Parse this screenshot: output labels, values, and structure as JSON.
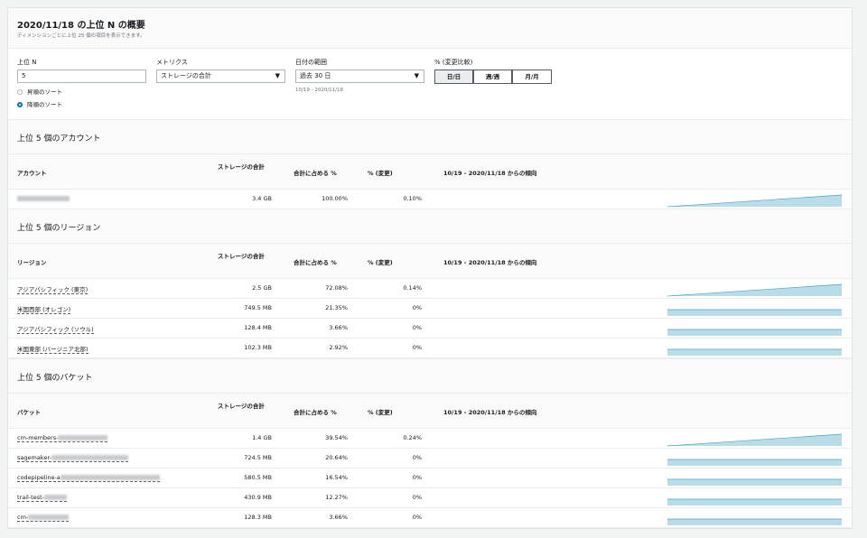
{
  "header": {
    "title": "2020/11/18 の上位 N の概要",
    "subtitle": "ディメンションごとに上位 25 個の項目を表示できます。"
  },
  "controls": {
    "topn_label": "上位 N",
    "topn_value": "5",
    "sort_asc": "昇順のソート",
    "sort_desc": "降順のソート",
    "metrics_label": "メトリクス",
    "metrics_value": "ストレージの合計",
    "date_label": "日付の範囲",
    "date_value": "過去 30 日",
    "date_hint": "10/19 - 2020/11/18",
    "compare_label": "% (変更比較)",
    "compare_options": [
      "日/日",
      "週/週",
      "月/月"
    ]
  },
  "columns": {
    "storage": "ストレージの合計",
    "percent": "合計に占める %",
    "change": "% (変更)",
    "trend": "10/19 - 2020/11/18 からの傾向"
  },
  "accounts": {
    "title": "上位 5 個のアカウント",
    "col_name": "アカウント",
    "rows": [
      {
        "name": "",
        "storage": "3.4 GB",
        "percent": "100.00%",
        "change": "0.10%",
        "trend": "rising"
      }
    ]
  },
  "regions": {
    "title": "上位 5 個のリージョン",
    "col_name": "リージョン",
    "rows": [
      {
        "name": "アジアパシフィック (東京)",
        "storage": "2.5 GB",
        "percent": "72.08%",
        "change": "0.14%",
        "trend": "rising"
      },
      {
        "name": "米国西部 (オレゴン)",
        "storage": "749.5 MB",
        "percent": "21.35%",
        "change": "0%",
        "trend": "flat"
      },
      {
        "name": "アジアパシフィック (ソウル)",
        "storage": "128.4 MB",
        "percent": "3.66%",
        "change": "0%",
        "trend": "flat"
      },
      {
        "name": "米国東部 (バージニア北部)",
        "storage": "102.3 MB",
        "percent": "2.92%",
        "change": "0%",
        "trend": "flat"
      }
    ]
  },
  "buckets": {
    "title": "上位 5 個のバケット",
    "col_name": "バケット",
    "rows": [
      {
        "name": "cm-members-",
        "storage": "1.4 GB",
        "percent": "39.54%",
        "change": "0.24%",
        "trend": "rising"
      },
      {
        "name": "sagemaker-",
        "storage": "724.5 MB",
        "percent": "20.64%",
        "change": "0%",
        "trend": "flat"
      },
      {
        "name": "codepipeline-a",
        "storage": "580.5 MB",
        "percent": "16.54%",
        "change": "0%",
        "trend": "flat"
      },
      {
        "name": "trail-test-",
        "storage": "430.9 MB",
        "percent": "12.27%",
        "change": "0%",
        "trend": "flat"
      },
      {
        "name": "cm-",
        "storage": "128.3 MB",
        "percent": "3.66%",
        "change": "0%",
        "trend": "flat"
      }
    ]
  },
  "colors": {
    "trend_fill": "#b9dce9",
    "trend_line": "#4aa3c4",
    "accent": "#0073bb"
  }
}
